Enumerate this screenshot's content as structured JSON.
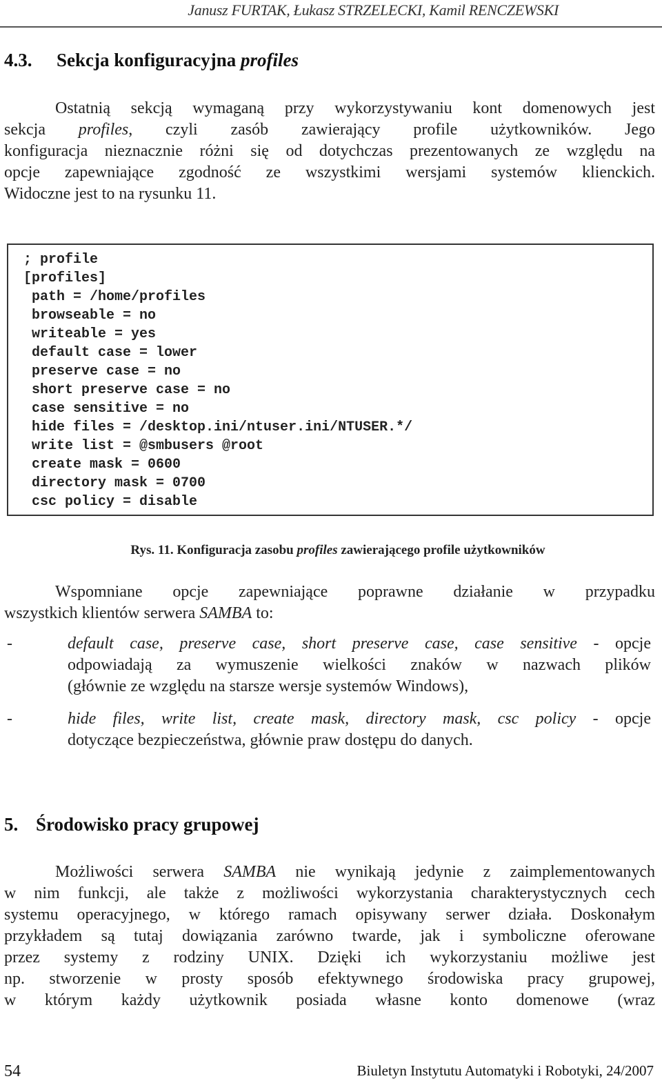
{
  "header": {
    "authors": "Janusz FURTAK, Łukasz STRZELECKI, Kamil RENCZEWSKI"
  },
  "section_4_3": {
    "number": "4.3.",
    "title_plain": "Sekcja konfiguracyjna ",
    "title_italic": "profiles"
  },
  "para1": {
    "l1": "Ostatnią sekcją wymaganą przy wykorzystywaniu kont domenowych jest",
    "l2a": "sekcja ",
    "l2b": "profiles",
    "l2c": ", czyli zasób zawierający profile użytkowników. Jego",
    "l3": "konfiguracja nieznacznie różni się od dotychczas prezentowanych ze względu na",
    "l4": "opcje zapewniające zgodność ze wszystkimi wersjami systemów klienckich.",
    "l5": "Widoczne jest to na rysunku 11."
  },
  "code": {
    "lines": [
      "; profile",
      "[profiles]",
      " path = /home/profiles",
      " browseable = no",
      " writeable = yes",
      " default case = lower",
      " preserve case = no",
      " short preserve case = no",
      " case sensitive = no",
      " hide files = /desktop.ini/ntuser.ini/NTUSER.*/",
      " write list = @smbusers @root",
      " create mask = 0600",
      " directory mask = 0700",
      " csc policy = disable"
    ]
  },
  "caption": {
    "a": "Rys. 11. Konfiguracja zasobu ",
    "b": "profiles",
    "c": " zawierającego profile użytkowników"
  },
  "para2": {
    "l1": "Wspomniane opcje zapewniające poprawne działanie w przypadku",
    "l2a": "wszystkich klientów serwera ",
    "l2b": "SAMBA",
    "l2c": " to:"
  },
  "bullets": [
    {
      "dash": "-",
      "l1_italic": "default case, preserve case, short preserve case, case sensitive",
      "l1_rest": " - opcje",
      "l2": "odpowiadają za wymuszenie wielkości znaków w nazwach plików",
      "l3": "(głównie ze względu na starsze wersje systemów Windows),"
    },
    {
      "dash": "-",
      "l1_italic": "hide files, write list, create mask, directory mask, csc policy",
      "l1_rest": " - opcje",
      "l2": "dotyczące bezpieczeństwa, głównie praw dostępu do danych."
    }
  ],
  "section_5": {
    "number": "5.",
    "title": "Środowisko pracy grupowej"
  },
  "para3": {
    "l1a": "Możliwości serwera ",
    "l1b": "SAMBA",
    "l1c": " nie wynikają jedynie z zaimplementowanych",
    "l2": "w nim funkcji, ale także z możliwości wykorzystania charakterystycznych cech",
    "l3": "systemu operacyjnego, w którego ramach opisywany serwer działa. Doskonałym",
    "l4": "przykładem są tutaj dowiązania zarówno twarde, jak i symboliczne oferowane",
    "l5": "przez systemy z rodziny UNIX. Dzięki ich wykorzystaniu możliwe jest",
    "l6": "np. stworzenie w prosty sposób efektywnego środowiska pracy grupowej,",
    "l7": "w którym każdy użytkownik posiada własne konto domenowe (wraz"
  },
  "footer": {
    "page_number": "54",
    "journal": "Biuletyn Instytutu Automatyki i Robotyki, 24/2007"
  }
}
